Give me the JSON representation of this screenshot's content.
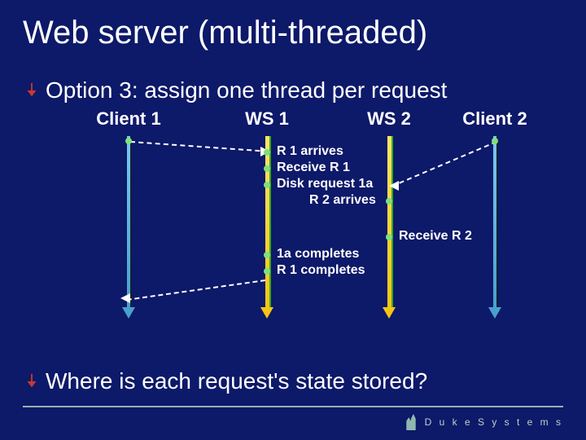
{
  "title": "Web server (multi-threaded)",
  "bullet1": "Option 3: assign one thread per request",
  "columns": {
    "client1": "Client 1",
    "ws1": "WS 1",
    "ws2": "WS 2",
    "client2": "Client 2"
  },
  "events": {
    "r1_arrives": "R 1 arrives",
    "receive_r1": "Receive R 1",
    "disk_1a": "Disk request 1a",
    "r2_arrives": "R 2 arrives",
    "receive_r2": "Receive R 2",
    "c1a": "1a completes",
    "r1_completes": "R 1 completes"
  },
  "bullet2": "Where is each request's state stored?",
  "footer": "D u k e    S y s t e m s",
  "chart_data": {
    "type": "table",
    "title": "Sequence of events across 4 lifelines",
    "lifelines": [
      "Client 1",
      "WS 1",
      "WS 2",
      "Client 2"
    ],
    "messages": [
      {
        "from": "Client 1",
        "to": "WS 1",
        "label": "R 1 arrives",
        "order": 1
      },
      {
        "at": "WS 1",
        "label": "Receive R 1",
        "order": 2
      },
      {
        "at": "WS 1",
        "label": "Disk request 1a",
        "order": 3
      },
      {
        "from": "Client 2",
        "to": "WS 2",
        "label": "R 2 arrives",
        "order": 4
      },
      {
        "at": "WS 2",
        "label": "Receive R 2",
        "order": 5
      },
      {
        "at": "WS 1",
        "label": "1a completes",
        "order": 6
      },
      {
        "from": "WS 1",
        "to": "Client 1",
        "label": "R 1 completes",
        "order": 7
      }
    ]
  }
}
